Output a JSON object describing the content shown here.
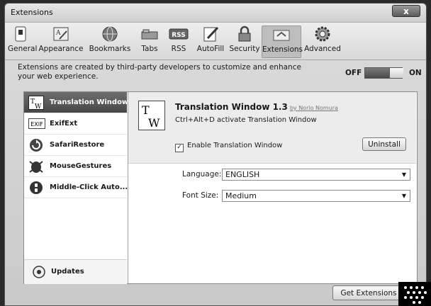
{
  "window": {
    "title": "Extensions",
    "close_label": "x"
  },
  "toolbar": {
    "items": [
      {
        "label": "General"
      },
      {
        "label": "Appearance"
      },
      {
        "label": "Bookmarks"
      },
      {
        "label": "Tabs"
      },
      {
        "label": "RSS",
        "icon_text": "RSS"
      },
      {
        "label": "AutoFill"
      },
      {
        "label": "Security"
      },
      {
        "label": "Extensions",
        "active": true
      },
      {
        "label": "Advanced"
      }
    ]
  },
  "header": {
    "description": "Extensions are created by third-party developers to customize and enhance your web experience.",
    "toggle": {
      "off_label": "OFF",
      "on_label": "ON",
      "state": "on"
    }
  },
  "sidebar": {
    "items": [
      {
        "label": "Translation Window",
        "selected": true
      },
      {
        "label": "ExifExt",
        "icon_text": "EXIF"
      },
      {
        "label": "SafariRestore"
      },
      {
        "label": "MouseGestures"
      },
      {
        "label": "Middle-Click Auto..."
      }
    ],
    "updates_label": "Updates"
  },
  "detail": {
    "title": "Translation Window 1.3",
    "author": "by Norio Nomura",
    "description": "Ctrl+Alt+D activate Translation Window",
    "enable_label": "Enable Translation Window",
    "enabled": true,
    "uninstall_label": "Uninstall",
    "language": {
      "label": "Language:",
      "value": "ENGLISH"
    },
    "font_size": {
      "label": "Font Size:",
      "value": "Medium"
    }
  },
  "footer": {
    "get_extensions_label": "Get Extensions",
    "help_label": "?"
  }
}
